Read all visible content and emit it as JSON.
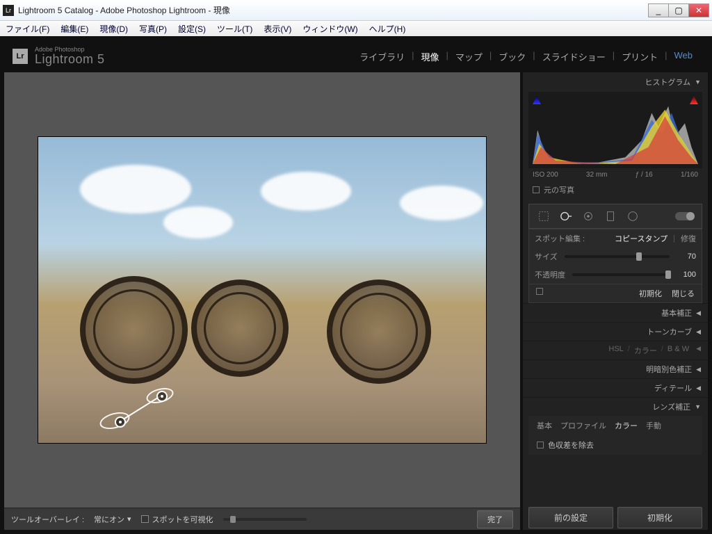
{
  "window": {
    "title": "Lightroom 5 Catalog - Adobe Photoshop Lightroom - 現像"
  },
  "menu": {
    "file": "ファイル(F)",
    "edit": "編集(E)",
    "develop": "現像(D)",
    "photo": "写真(P)",
    "settings": "設定(S)",
    "tool": "ツール(T)",
    "view": "表示(V)",
    "window": "ウィンドウ(W)",
    "help": "ヘルプ(H)"
  },
  "brand": {
    "small": "Adobe Photoshop",
    "large": "Lightroom 5",
    "mark": "Lr"
  },
  "modules": {
    "library": "ライブラリ",
    "develop": "現像",
    "map": "マップ",
    "book": "ブック",
    "slideshow": "スライドショー",
    "print": "プリント",
    "web": "Web"
  },
  "toolbar": {
    "overlay_label": "ツールオーバーレイ :",
    "overlay_value": "常にオン",
    "visualize": "スポットを可視化",
    "done": "完了"
  },
  "right": {
    "histogram": "ヒストグラム",
    "iso": "ISO 200",
    "focal": "32 mm",
    "aperture": "ƒ / 16",
    "shutter": "1/160",
    "original": "元の写真",
    "spot_title": "スポット編集 :",
    "clone": "コピースタンプ",
    "heal": "修復",
    "size_label": "サイズ",
    "size_val": "70",
    "opacity_label": "不透明度",
    "opacity_val": "100",
    "reset": "初期化",
    "close": "閉じる",
    "basic": "基本補正",
    "tonecurve": "トーンカーブ",
    "hsl": "HSL",
    "color": "カラー",
    "bw": "B & W",
    "splittone": "明暗別色補正",
    "detail": "ディテール",
    "lenscorr": "レンズ補正",
    "lens_basic": "基本",
    "lens_profile": "プロファイル",
    "lens_color": "カラー",
    "lens_manual": "手動",
    "remove_ca": "色収差を除去",
    "prev_settings": "前の設定",
    "reset_btn": "初期化"
  }
}
